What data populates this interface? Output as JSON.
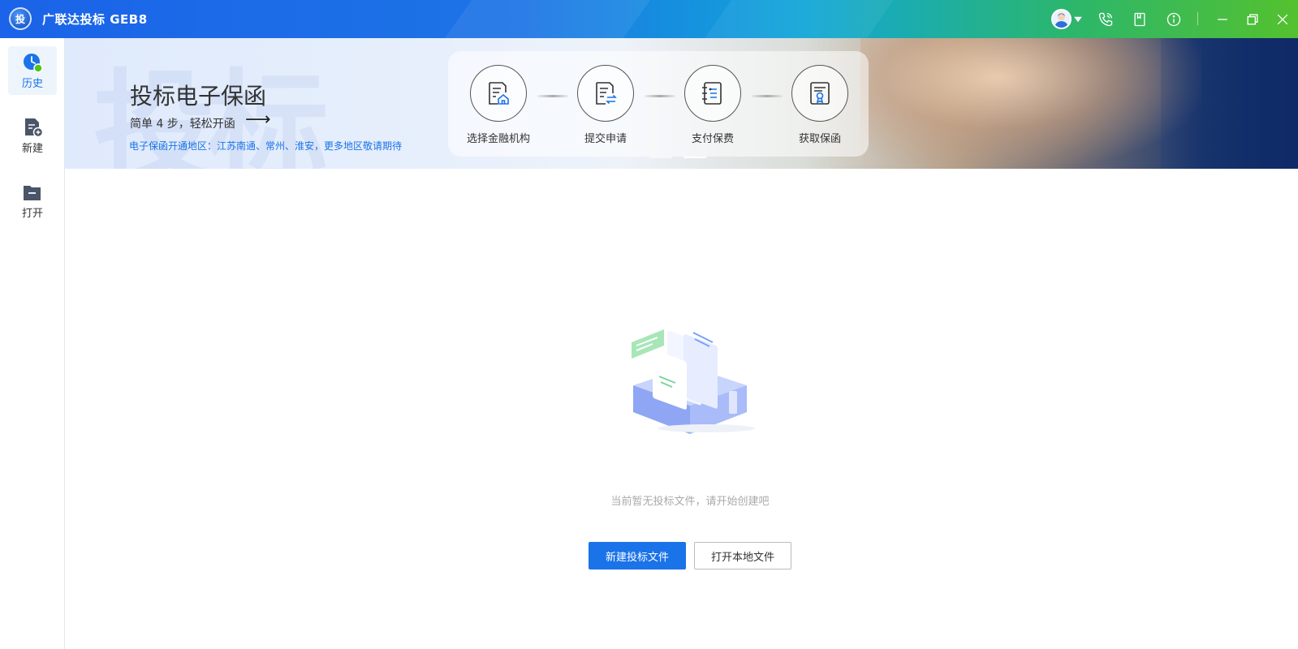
{
  "window": {
    "logo_text": "投",
    "title": "广联达投标 GEB8",
    "icons": [
      "avatar-icon",
      "caret-down-icon",
      "phone-icon",
      "book-icon",
      "info-icon",
      "minimize-icon",
      "restore-icon",
      "close-icon"
    ]
  },
  "sidebar": {
    "items": [
      {
        "label": "历史",
        "icon": "clock-icon",
        "active": true
      },
      {
        "label": "新建",
        "icon": "new-file-icon",
        "active": false
      },
      {
        "label": "打开",
        "icon": "folder-icon",
        "active": false
      }
    ]
  },
  "banner": {
    "ghost_text": "投标",
    "title": "投标电子保函",
    "subtitle": "简单 4 步，轻松开函",
    "arrow": "⟶",
    "note": "电子保函开通地区：江苏南通、常州、淮安，更多地区敬请期待",
    "steps": [
      {
        "label": "选择金融机构",
        "icon": "document-home-icon"
      },
      {
        "label": "提交申请",
        "icon": "document-swap-icon"
      },
      {
        "label": "支付保费",
        "icon": "ledger-icon"
      },
      {
        "label": "获取保函",
        "icon": "certificate-icon"
      }
    ]
  },
  "empty_state": {
    "message": "当前暂无投标文件，请开始创建吧",
    "illustration": "empty-files-illustration"
  },
  "actions": {
    "new_label": "新建投标文件",
    "open_label": "打开本地文件"
  },
  "colors": {
    "accent": "#1a73e8",
    "sidebar_active_bg": "#eef4fc",
    "muted_text": "#aaaaaa"
  }
}
